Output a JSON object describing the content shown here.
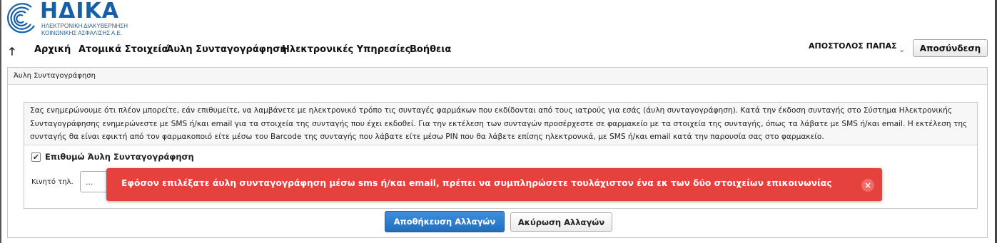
{
  "header": {
    "logo_text": "ΗΔΙΚΑ",
    "logo_subtitle_line1": "ΗΛΕΚΤΡΟΝΙΚΗ ΔΙΑΚΥΒΕΡΝΗΣΗ",
    "logo_subtitle_line2": "ΚΟΙΝΩΝΙΚΗΣ ΑΣΦΑΛΙΣΗΣ Α.Ε."
  },
  "nav": {
    "up_arrow": "🡑",
    "items": [
      {
        "label": "Αρχική"
      },
      {
        "label": "Ατομικά Στοιχεία"
      },
      {
        "label": "Άυλη Συνταγογράφηση"
      },
      {
        "label": "Ηλεκτρονικές Υπηρεσίες"
      },
      {
        "label": "Βοήθεια"
      }
    ],
    "dropdown_chevron": "⌄",
    "user_name": "ΑΠΟΣΤΟΛΟΣ ΠΑΠΑΣ",
    "logout_label": "Αποσύνδεση"
  },
  "panel": {
    "title": "Άυλη Συνταγογράφηση",
    "notice_lines": [
      "Σας ενημερώνουμε ότι πλέον μπορείτε, εάν επιθυμείτε, να λαμβάνετε με ηλεκτρονικό τρόπο τις συνταγές φαρμάκων που εκδίδονται από τους ιατρούς για εσάς (άυλη συνταγογράφηση). Κατά την έκδοση συνταγής στο Σύστημα Ηλεκτρονικής",
      "Συνταγογράφησης ενημερώνεστε με SMS ή/και email για τα στοιχεία της συνταγής που έχει εκδοθεί. Για την εκτέλεση των συνταγών προσέρχεστε σε φαρμακείο με τα στοιχεία της συνταγής, όπως τα λάβατε με SMS ή/και email. Η εκτέλεση της",
      "συνταγής θα είναι εφικτή από τον φαρμακοποιό είτε μέσω του Barcode της συνταγής που λάβατε είτε μέσω PIN που θα λάβετε επίσης ηλεκτρονικά, με SMS ή/και email κατά την παρουσία σας στο φαρμακείο."
    ],
    "checkbox_label": "Επιθυμώ Άυλη Συνταγογράφηση",
    "checkbox_checked": true,
    "checkmark": "✔",
    "phone_label": "Κινητό τηλ.",
    "phone_value": "...",
    "save_label": "Αποθήκευση Αλλαγών",
    "cancel_label": "Ακύρωση Αλλαγών"
  },
  "toast": {
    "message": "Εφόσον επιλέξατε άυλη συνταγογράφηση μέσω sms ή/και email, πρέπει να συμπληρώσετε τουλάχιστον ένα εκ των δύο στοιχείων επικοινωνίας",
    "close_glyph": "×",
    "color": "#e5413d"
  },
  "colors": {
    "brand": "#1560a8",
    "primary_button": "#1f6fc2"
  }
}
